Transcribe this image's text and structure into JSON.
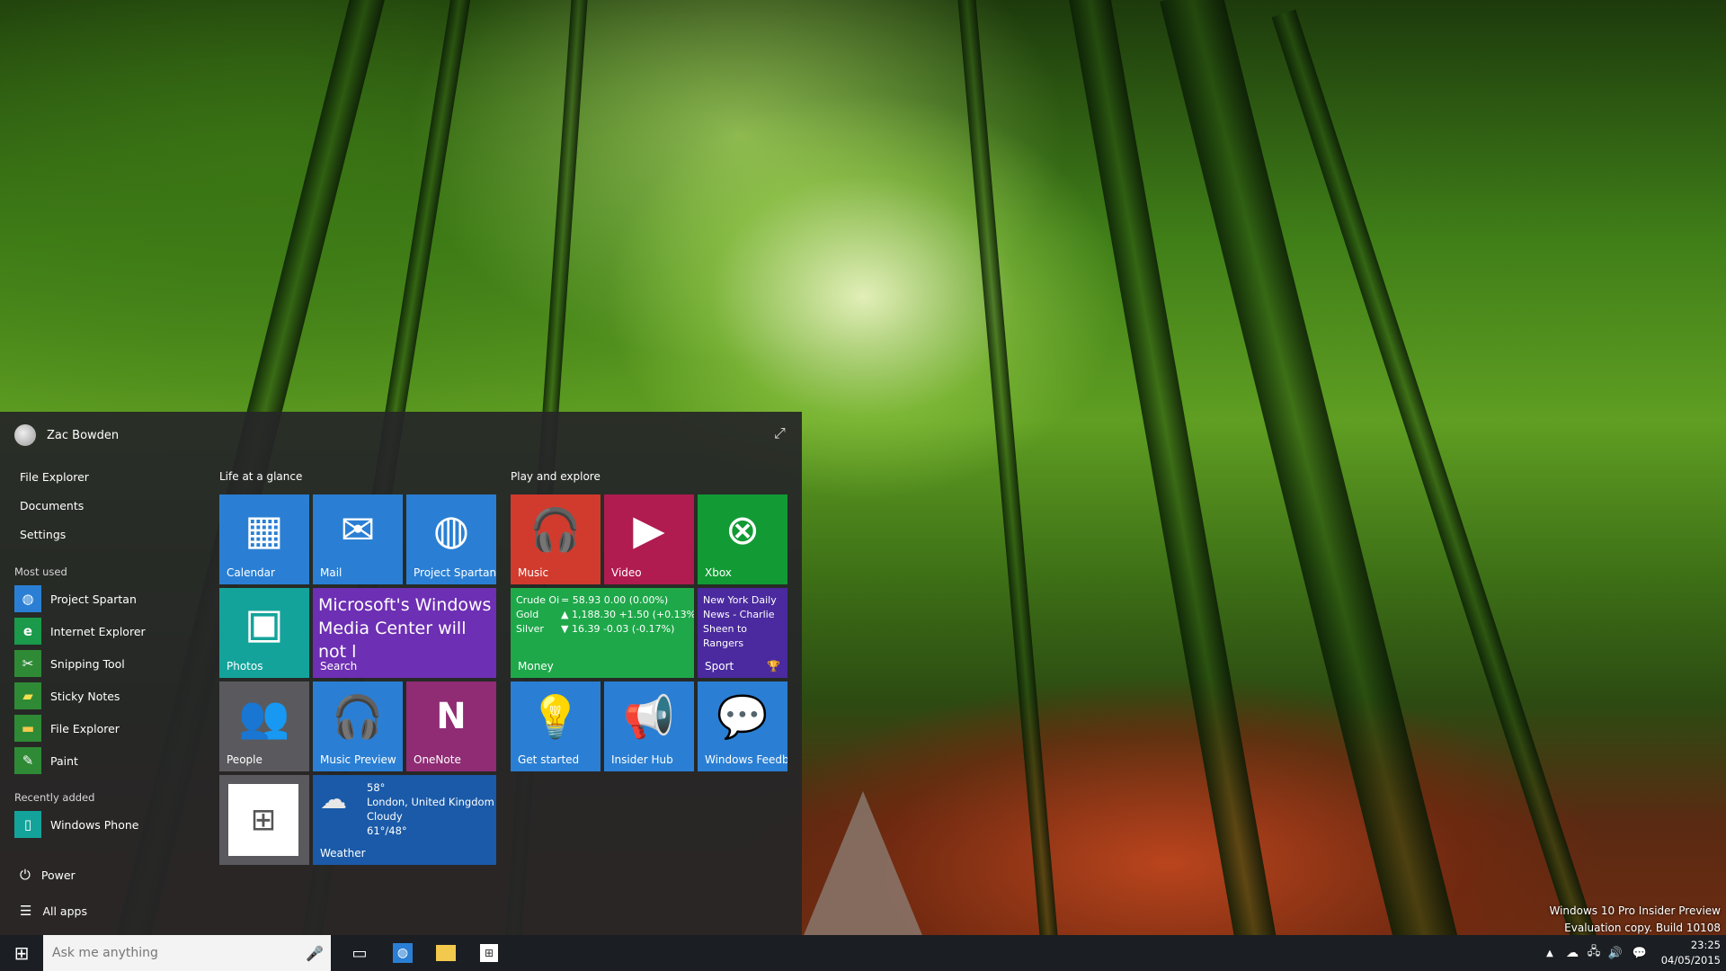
{
  "colors": {
    "blue": "#2a7fd4",
    "teal": "#14a39a",
    "purple": "#6d2fb3",
    "red": "#d13b2e",
    "crimson": "#b01b50",
    "green": "#129a35",
    "green2": "#1ea84a",
    "indigo": "#4a2a9e",
    "magenta": "#8f2c74",
    "gray": "#5a5a5e",
    "darkblue": "#1a5aa8"
  },
  "desktop": {
    "watermark": {
      "line1": "Windows 10 Pro Insider Preview",
      "line2": "Evaluation copy. Build 10108"
    }
  },
  "start_menu": {
    "user_name": "Zac Bowden",
    "expand_icon": "expand-icon",
    "places": [
      "File Explorer",
      "Documents",
      "Settings"
    ],
    "most_used_label": "Most used",
    "most_used": [
      {
        "label": "Project Spartan",
        "icon": "globe-icon"
      },
      {
        "label": "Internet Explorer",
        "icon": "ie-icon"
      },
      {
        "label": "Snipping Tool",
        "icon": "scissors-icon"
      },
      {
        "label": "Sticky Notes",
        "icon": "note-icon"
      },
      {
        "label": "File Explorer",
        "icon": "folder-icon"
      },
      {
        "label": "Paint",
        "icon": "palette-icon"
      }
    ],
    "recently_added_label": "Recently added",
    "recently_added": [
      {
        "label": "Windows Phone",
        "icon": "phone-icon"
      }
    ],
    "power_label": "Power",
    "all_apps_label": "All apps",
    "groups": {
      "life": "Life at a glance",
      "play": "Play and explore"
    },
    "tiles": {
      "calendar": "Calendar",
      "mail": "Mail",
      "spartan": "Project Spartan",
      "photos": "Photos",
      "search": {
        "headline": "Microsoft's Windows Media Center will not l",
        "label": "Search"
      },
      "people": "People",
      "music_preview": "Music Preview",
      "onenote": "OneNote",
      "weather": {
        "temp": "58°",
        "location": "London, United Kingdom",
        "condition": "Cloudy",
        "range": "61°/48°",
        "label": "Weather"
      },
      "music": "Music",
      "video": "Video",
      "xbox": "Xbox",
      "money": {
        "label": "Money",
        "rows": [
          {
            "name": "Crude Oi",
            "arrow": "=",
            "value": "58.93 0.00 (0.00%)"
          },
          {
            "name": "Gold",
            "arrow": "▲",
            "value": "1,188.30 +1.50 (+0.13%"
          },
          {
            "name": "Silver",
            "arrow": "▼",
            "value": "16.39 -0.03 (-0.17%)"
          }
        ]
      },
      "sport": {
        "headline": "New York Daily News - Charlie Sheen to Rangers outfielder Josh Ha",
        "label": "Sport"
      },
      "get_started": "Get started",
      "insider_hub": "Insider Hub",
      "feedback": "Windows Feedb"
    }
  },
  "taskbar": {
    "search_placeholder": "Ask me anything",
    "time": "23:25",
    "date": "04/05/2015"
  }
}
